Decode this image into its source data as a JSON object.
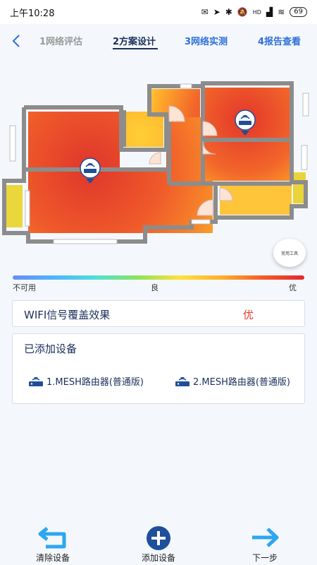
{
  "status": {
    "time": "上午10:28",
    "network": "HD",
    "battery": "69"
  },
  "steps": [
    {
      "label": "1网络评估"
    },
    {
      "label": "2方案设计"
    },
    {
      "label": "3网络实测"
    },
    {
      "label": "4报告查看"
    }
  ],
  "tool_button": {
    "label": "常用工具"
  },
  "legend": {
    "low": "不可用",
    "mid": "良",
    "high": "优"
  },
  "coverage": {
    "label": "WIFI信号覆盖效果",
    "value": "优"
  },
  "devices": {
    "title": "已添加设备",
    "items": [
      {
        "label": "1.MESH路由器(普通版)"
      },
      {
        "label": "2.MESH路由器(普通版)"
      }
    ]
  },
  "bottom": {
    "clear": "清除设备",
    "add": "添加设备",
    "next": "下一步"
  },
  "colors": {
    "accent": "#2f6fd8",
    "active_step": "#1a2f5a",
    "excellent": "#e33a2b"
  }
}
